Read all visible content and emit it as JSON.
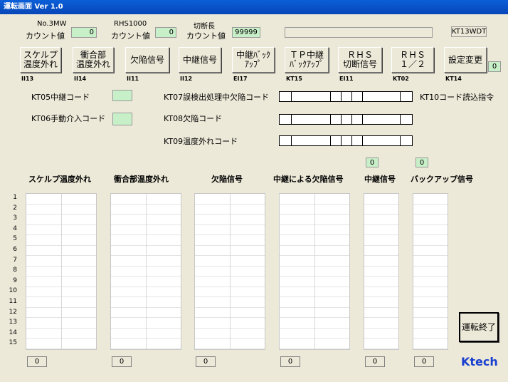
{
  "window": {
    "title": "運転画面 Ver 1.0"
  },
  "counters": {
    "no3mw_label": "No.3MW",
    "no3mw_sub": "カウント値",
    "no3mw_value": "0",
    "rhs_label": "RHS1000",
    "rhs_sub": "カウント値",
    "rhs_value": "0",
    "cut_label": "切断長",
    "cut_sub": "カウント値",
    "cut_value": "99999",
    "status_text": "",
    "kt13": "KT13WDT"
  },
  "buttons": [
    {
      "label": "スケルプ\n温度外れ",
      "code": "II13"
    },
    {
      "label": "衝合部\n温度外れ",
      "code": "II14"
    },
    {
      "label": "欠陥信号",
      "code": "II11"
    },
    {
      "label": "中継信号",
      "code": "II12"
    },
    {
      "label": "中継ﾊﾞｯｸ\nｱｯﾌﾟ",
      "code": "EI17"
    },
    {
      "label": "ＴＰ中継\nﾊﾞｯｸｱｯﾌﾟ",
      "code": "KT15"
    },
    {
      "label": "ＲＨＳ\n切断信号",
      "code": "EI11"
    },
    {
      "label": "ＲＨＳ\n１／２",
      "code": "KT02"
    },
    {
      "label": "設定変更",
      "code": "KT14"
    }
  ],
  "setting_value": "0",
  "codes": {
    "kt05": "KT05中継コード",
    "kt06": "KT06手動介入コード",
    "kt07": "KT07誤検出処理中欠陥コード",
    "kt08": "KT08欠陥コード",
    "kt09": "KT09温度外れコード",
    "kt10": "KT10コード読込指令"
  },
  "indicators": {
    "relay": "0",
    "backup": "0"
  },
  "columns": [
    {
      "title": "スケルプ温度外れ",
      "total": "0"
    },
    {
      "title": "衝合部温度外れ",
      "total": "0"
    },
    {
      "title": "欠陥信号",
      "total": "0"
    },
    {
      "title": "中継による欠陥信号",
      "total": "0"
    },
    {
      "title": "中継信号",
      "total": "0"
    },
    {
      "title": "バックアップ信号",
      "total": "0"
    }
  ],
  "row_numbers": [
    "1",
    "2",
    "3",
    "4",
    "5",
    "6",
    "7",
    "8",
    "9",
    "10",
    "11",
    "12",
    "13",
    "14",
    "15"
  ],
  "end_button": "運転終了",
  "brand": "Ktech"
}
